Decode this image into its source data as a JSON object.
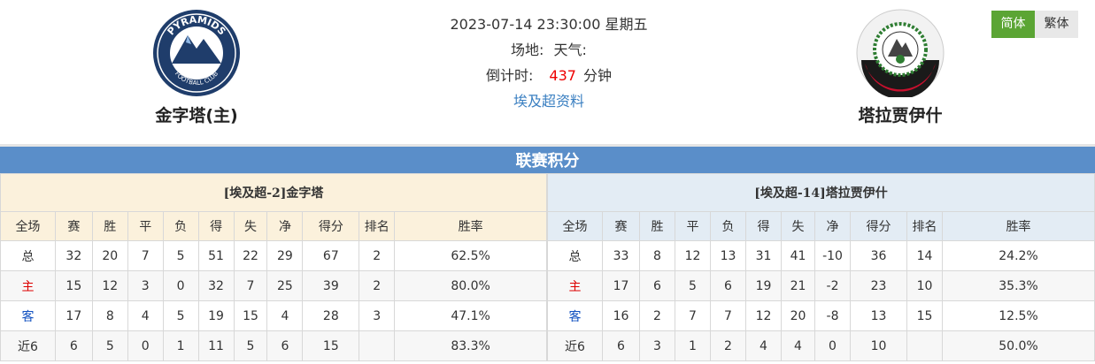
{
  "match": {
    "datetime": "2023-07-14 23:30:00 星期五",
    "venue_label": "场地:",
    "weather_label": "天气:",
    "countdown_label": "倒计时:",
    "countdown_value": "437",
    "countdown_unit": "分钟",
    "league_link": "埃及超资料"
  },
  "home_team": {
    "name": "金字塔(主)",
    "logo_text": "PYRAMIDS",
    "logo_subtext": "FOOTBALL CLUB"
  },
  "away_team": {
    "name": "塔拉贾伊什"
  },
  "lang": {
    "simplified": "简体",
    "traditional": "繁体"
  },
  "section_title": "联赛积分",
  "columns": [
    "全场",
    "赛",
    "胜",
    "平",
    "负",
    "得",
    "失",
    "净",
    "得分",
    "排名",
    "胜率"
  ],
  "home_table": {
    "title": "[埃及超-2]金字塔",
    "rows": [
      [
        "总",
        "32",
        "20",
        "7",
        "5",
        "51",
        "22",
        "29",
        "67",
        "2",
        "62.5%"
      ],
      [
        "主",
        "15",
        "12",
        "3",
        "0",
        "32",
        "7",
        "25",
        "39",
        "2",
        "80.0%"
      ],
      [
        "客",
        "17",
        "8",
        "4",
        "5",
        "19",
        "15",
        "4",
        "28",
        "3",
        "47.1%"
      ],
      [
        "近6",
        "6",
        "5",
        "0",
        "1",
        "11",
        "5",
        "6",
        "15",
        "",
        "83.3%"
      ]
    ]
  },
  "away_table": {
    "title": "[埃及超-14]塔拉贾伊什",
    "rows": [
      [
        "总",
        "33",
        "8",
        "12",
        "13",
        "31",
        "41",
        "-10",
        "36",
        "14",
        "24.2%"
      ],
      [
        "主",
        "17",
        "6",
        "5",
        "6",
        "19",
        "21",
        "-2",
        "23",
        "10",
        "35.3%"
      ],
      [
        "客",
        "16",
        "2",
        "7",
        "7",
        "12",
        "20",
        "-8",
        "13",
        "15",
        "12.5%"
      ],
      [
        "近6",
        "6",
        "3",
        "1",
        "2",
        "4",
        "4",
        "0",
        "10",
        "",
        "50.0%"
      ]
    ]
  },
  "colors": {
    "accent_green": "#5ba534",
    "section_blue": "#5a8ec9",
    "countdown_red": "#e00000",
    "link_blue": "#3a7fc1"
  }
}
